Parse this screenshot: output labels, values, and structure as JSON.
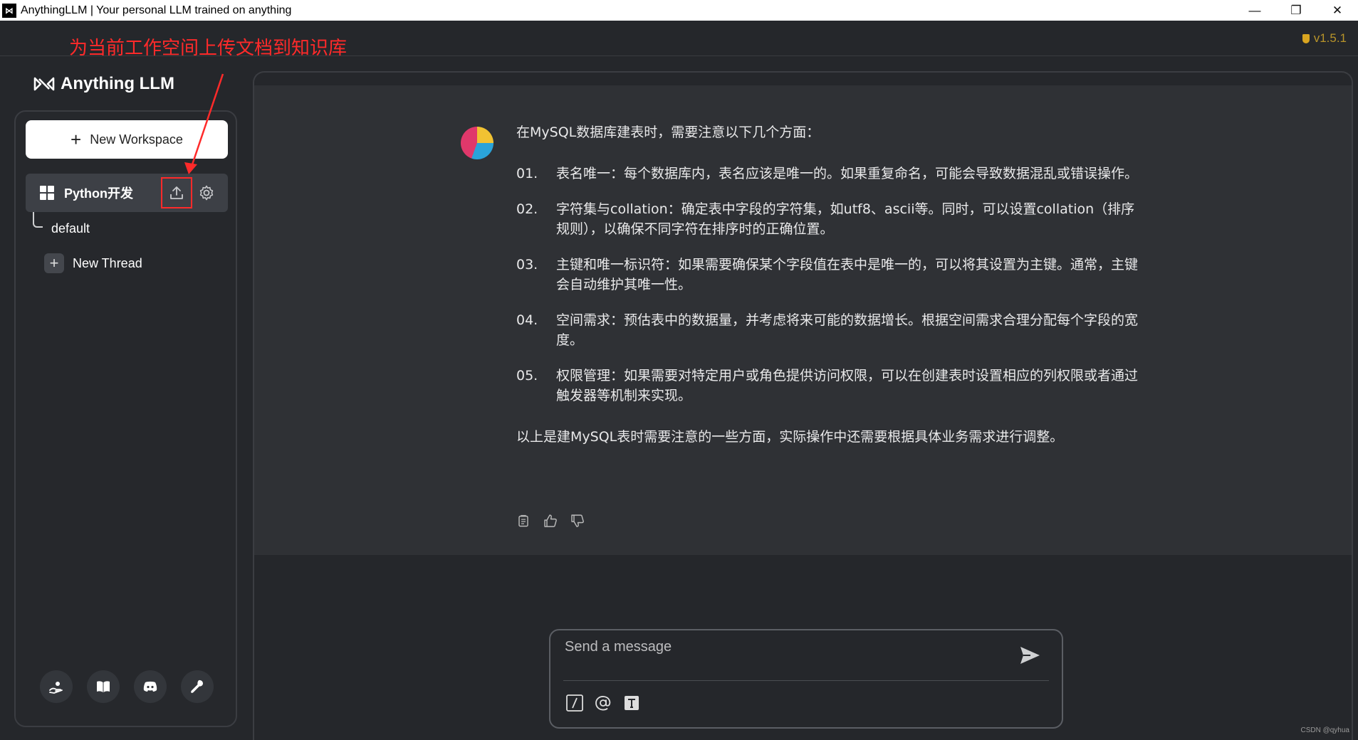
{
  "window": {
    "title": "AnythingLLM | Your personal LLM trained on anything",
    "controls": [
      "—",
      "❐",
      "✕"
    ]
  },
  "annotation": "为当前工作空间上传文档到知识库",
  "version": "v1.5.1",
  "brand": {
    "name": "Anything LLM"
  },
  "sidebar": {
    "new_workspace_label": "New Workspace",
    "workspace": {
      "name": "Python开发"
    },
    "threads": [
      {
        "label": "default"
      }
    ],
    "new_thread_label": "New Thread",
    "footer_icons": [
      "support-icon",
      "docs-book-icon",
      "discord-icon",
      "settings-wrench-icon"
    ]
  },
  "chat": {
    "message": {
      "intro": "在MySQL数据库建表时，需要注意以下几个方面：",
      "items": [
        {
          "num": "01.",
          "text": "表名唯一：每个数据库内，表名应该是唯一的。如果重复命名，可能会导致数据混乱或错误操作。"
        },
        {
          "num": "02.",
          "text": "字符集与collation：确定表中字段的字符集，如utf8、ascii等。同时，可以设置collation（排序规则），以确保不同字符在排序时的正确位置。"
        },
        {
          "num": "03.",
          "text": "主键和唯一标识符：如果需要确保某个字段值在表中是唯一的，可以将其设置为主键。通常，主键会自动维护其唯一性。"
        },
        {
          "num": "04.",
          "text": "空间需求：预估表中的数据量，并考虑将来可能的数据增长。根据空间需求合理分配每个字段的宽度。"
        },
        {
          "num": "05.",
          "text": "权限管理：如果需要对特定用户或角色提供访问权限，可以在创建表时设置相应的列权限或者通过触发器等机制来实现。"
        }
      ],
      "outro": "以上是建MySQL表时需要注意的一些方面，实际操作中还需要根据具体业务需求进行调整。"
    },
    "input": {
      "placeholder": "Send a message"
    }
  },
  "watermark": "CSDN @qyhua",
  "colors": {
    "background": "#25272b",
    "message_bg": "#2f3135",
    "annotation_red": "#ff2a2a",
    "version_gold": "#b8942a"
  }
}
